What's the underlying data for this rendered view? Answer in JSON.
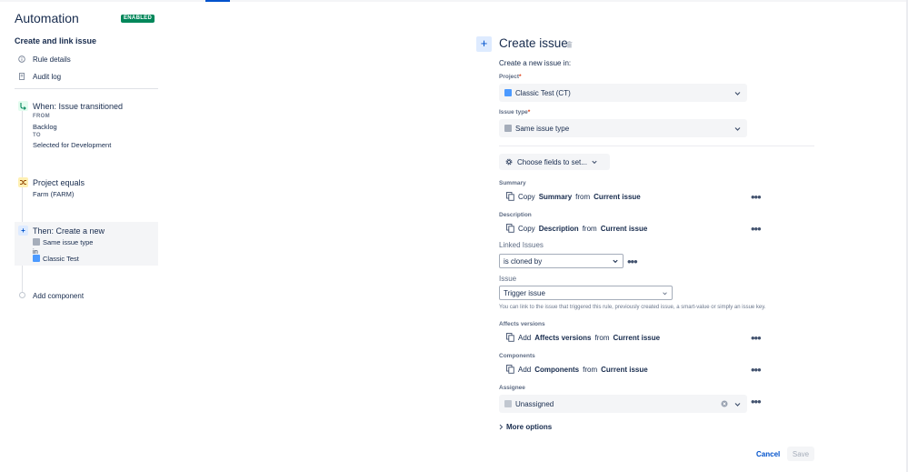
{
  "header": {
    "title": "Automation",
    "status_badge": "ENABLED"
  },
  "sidebar": {
    "rule_name": "Create and link issue",
    "nav": [
      {
        "label": "Rule details",
        "icon": "info-icon"
      },
      {
        "label": "Audit log",
        "icon": "document-icon"
      }
    ],
    "trigger": {
      "title": "When: Issue transitioned",
      "from_label": "FROM",
      "from_value": "Backlog",
      "to_label": "TO",
      "to_value": "Selected for Development"
    },
    "condition": {
      "title": "Project equals",
      "value": "Farm (FARM)"
    },
    "action": {
      "title": "Then: Create a new",
      "issue_type": "Same issue type",
      "in_label": "in",
      "project": "Classic Test"
    },
    "add_component": "Add component"
  },
  "editor": {
    "title": "Create issue",
    "intro": "Create a new issue in:",
    "project": {
      "label": "Project",
      "value": "Classic Test (CT)"
    },
    "issue_type": {
      "label": "Issue type",
      "value": "Same issue type"
    },
    "choose_fields": "Choose fields to set...",
    "summary": {
      "label": "Summary",
      "action": "Copy",
      "field": "Summary",
      "from": "from",
      "source": "Current issue"
    },
    "description": {
      "label": "Description",
      "action": "Copy",
      "field": "Description",
      "from": "from",
      "source": "Current issue"
    },
    "linked_issues": {
      "label": "Linked Issues",
      "value": "is cloned by"
    },
    "issue": {
      "label": "Issue",
      "value": "Trigger issue",
      "helper": "You can link to the issue that triggered this rule, previously created issue, a smart-value or simply an issue key."
    },
    "affects_versions": {
      "label": "Affects versions",
      "action": "Add",
      "field": "Affects versions",
      "from": "from",
      "source": "Current issue"
    },
    "components": {
      "label": "Components",
      "action": "Add",
      "field": "Components",
      "from": "from",
      "source": "Current issue"
    },
    "assignee": {
      "label": "Assignee",
      "value": "Unassigned"
    },
    "more_options": "More options",
    "cancel": "Cancel",
    "save": "Save"
  },
  "colors": {
    "accent": "#0052cc",
    "badge": "#00875a",
    "required": "#de350b",
    "field_bg": "#f4f5f7"
  }
}
